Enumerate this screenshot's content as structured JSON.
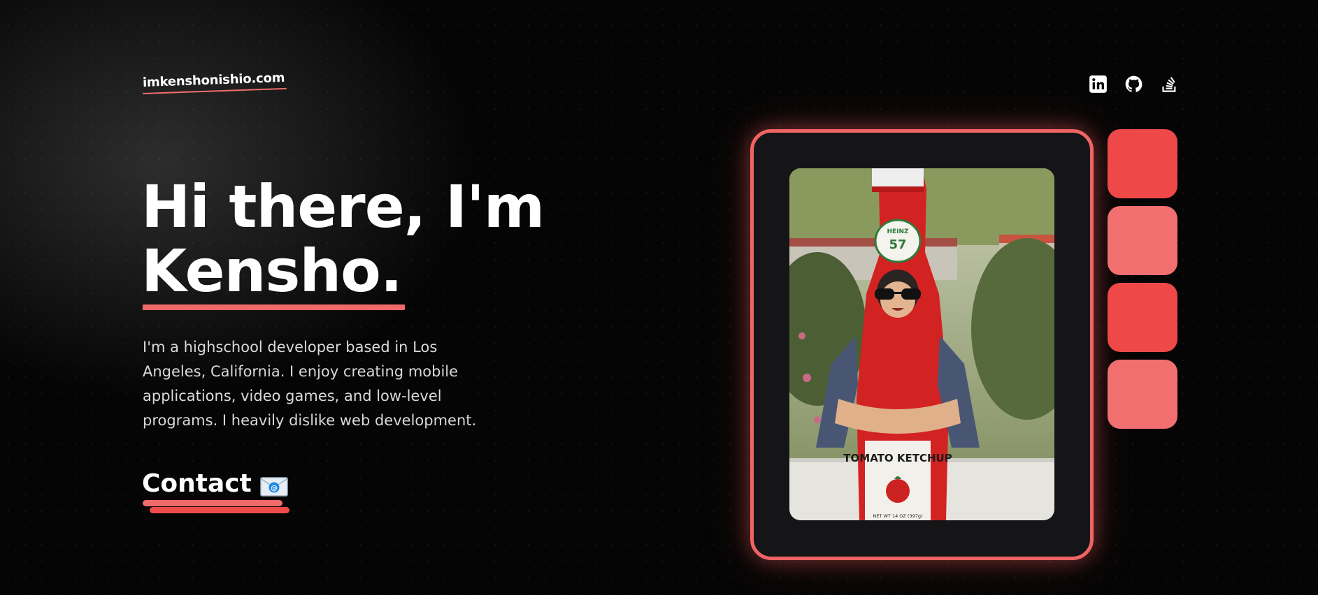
{
  "header": {
    "site_link": "imkenshonishio.com",
    "socials": [
      {
        "name": "linkedin-icon"
      },
      {
        "name": "github-icon"
      },
      {
        "name": "stackoverflow-icon"
      }
    ]
  },
  "hero": {
    "line1": "Hi there, I'm",
    "name": "Kensho.",
    "bio": "I'm a highschool developer based in Los Angeles, California. I enjoy creating mobile applications, video games, and low-level programs. I heavily dislike web development.",
    "contact_label": "Contact",
    "contact_icon": "envelope-icon"
  },
  "photo": {
    "label_brand": "HEINZ",
    "label_number": "57",
    "label_product": "TOMATO KETCHUP",
    "label_net": "NET WT 14 OZ (397g)"
  },
  "colors": {
    "accent": "#f06464",
    "tiles": [
      "#ee4848",
      "#f26f6f",
      "#ee4848",
      "#f26f6f"
    ]
  }
}
